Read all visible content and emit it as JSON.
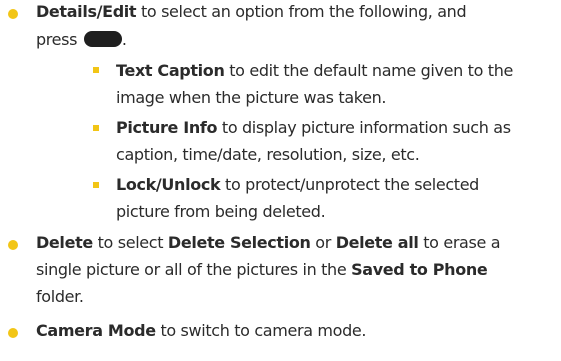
{
  "items": [
    {
      "bold": "Details/Edit",
      "line1_rest": " to select an option from the following, and",
      "line2": "press",
      "line2_end": ".",
      "key_icon": "menu-ok-key-icon",
      "subitems": [
        {
          "bold": "Text Caption",
          "line1_rest": " to edit the default name given to the",
          "line2": "image when the picture was taken."
        },
        {
          "bold": "Picture Info",
          "line1_rest": " to display picture information such as",
          "line2": "caption, time/date, resolution, size, etc."
        },
        {
          "bold": "Lock/Unlock",
          "line1_rest": " to protect/unprotect the selected",
          "line2": "picture from being deleted."
        }
      ]
    },
    {
      "bold": "Delete",
      "t1": " to select ",
      "bold2": "Delete Selection",
      "t2": " or ",
      "bold3": "Delete all",
      "t3": " to erase a",
      "line2a": "single picture or all of the pictures in the ",
      "line2b": "Saved to Phone",
      "line3": "folder."
    },
    {
      "bold": "Camera Mode",
      "line1_rest": " to switch to camera mode."
    }
  ],
  "colors": {
    "bullet": "#f2c516",
    "text": "#2b2b2b",
    "key": "#1f1f1f"
  }
}
